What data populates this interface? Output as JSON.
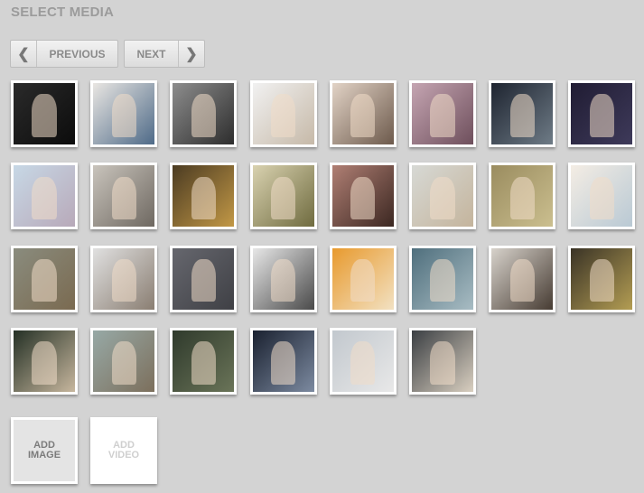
{
  "header": {
    "title": "SELECT MEDIA"
  },
  "nav": {
    "previous_label": "PREVIOUS",
    "next_label": "NEXT"
  },
  "add": {
    "image_label": "ADD IMAGE",
    "video_label": "ADD VIDEO"
  },
  "thumbnail_colors": [
    [
      "#2a2a2a",
      "#0c0c0c"
    ],
    [
      "#e9e6e2",
      "#4e6a88"
    ],
    [
      "#8d8d8d",
      "#2d2d2d"
    ],
    [
      "#f1f1f1",
      "#c6b9a8"
    ],
    [
      "#e2d3c6",
      "#6d5a4c"
    ],
    [
      "#c5a5b2",
      "#6e4f5c"
    ],
    [
      "#1e2430",
      "#6e7b86"
    ],
    [
      "#201c33",
      "#3e3a5a"
    ],
    [
      "#c7d8e6",
      "#b8a9b9"
    ],
    [
      "#c9c4bc",
      "#6e6861"
    ],
    [
      "#4b3b22",
      "#c29846"
    ],
    [
      "#d9d2b0",
      "#6f6b3f"
    ],
    [
      "#b07f74",
      "#3b2721"
    ],
    [
      "#d7d9d5",
      "#c4b49c"
    ],
    [
      "#9a8c5f",
      "#cbbf8f"
    ],
    [
      "#f4ede4",
      "#b9c9d4"
    ],
    [
      "#8a8c7e",
      "#7a6a50"
    ],
    [
      "#e0e0e0",
      "#8a7e72"
    ],
    [
      "#66676e",
      "#3f4045"
    ],
    [
      "#e7e7e7",
      "#4a4a4a"
    ],
    [
      "#e89a2e",
      "#f2e1c2"
    ],
    [
      "#4f6f7d",
      "#a8bcc3"
    ],
    [
      "#d7d2cb",
      "#473c33"
    ],
    [
      "#3a3326",
      "#b39d53"
    ],
    [
      "#243025",
      "#c7b79e"
    ],
    [
      "#97a9a6",
      "#7c6f5c"
    ],
    [
      "#2f3a2c",
      "#6a7458"
    ],
    [
      "#1a2130",
      "#7c8aa0"
    ],
    [
      "#c2c8ce",
      "#e8e8e8"
    ],
    [
      "#3b3f43",
      "#d9cfc0"
    ]
  ]
}
